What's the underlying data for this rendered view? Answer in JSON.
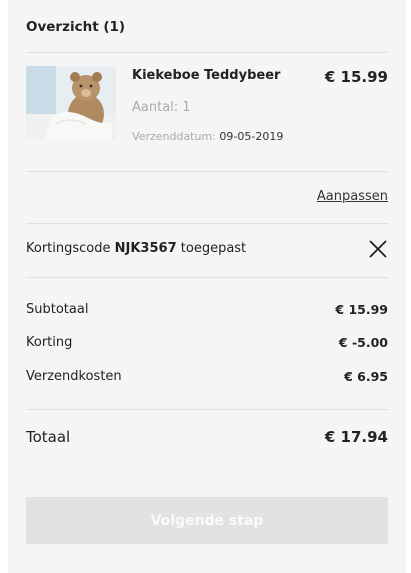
{
  "summary": {
    "title": "Overzicht (1)"
  },
  "item": {
    "name": "Kiekeboe Teddybeer",
    "price": "€ 15.99",
    "quantity": "Aantal: 1",
    "ship_label": "Verzenddatum:",
    "ship_date": "09-05-2019"
  },
  "edit_link": "Aanpassen",
  "promo": {
    "prefix": "Kortingscode",
    "code": "NJK3567",
    "suffix": "toegepast"
  },
  "totals": {
    "subtotal_label": "Subtotaal",
    "subtotal_value": "€ 15.99",
    "discount_label": "Korting",
    "discount_value": "€ -5.00",
    "shipping_label": "Verzendkosten",
    "shipping_value": "€ 6.95",
    "total_label": "Totaal",
    "total_value": "€ 17.94"
  },
  "next_button": "Volgende stap"
}
